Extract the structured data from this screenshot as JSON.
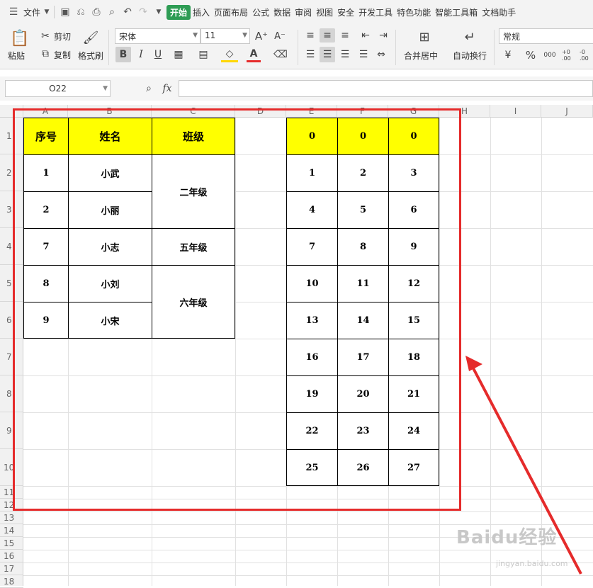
{
  "menu": {
    "file": "文件",
    "tabs": [
      "开始",
      "插入",
      "页面布局",
      "公式",
      "数据",
      "审阅",
      "视图",
      "安全",
      "开发工具",
      "特色功能",
      "智能工具箱",
      "文档助手"
    ]
  },
  "ribbon": {
    "paste": "粘贴",
    "cut": "剪切",
    "copy": "复制",
    "format_painter": "格式刷",
    "font_name": "宋体",
    "font_size": "11",
    "merge_center": "合并居中",
    "wrap_text": "自动换行",
    "number_format": "常规",
    "bold": "B",
    "italic": "I",
    "underline": "U",
    "font_color_glyph": "A",
    "percent": "%",
    "comma": "000",
    "dec_inc": "+0 .00",
    "dec_dec": "-0 .00"
  },
  "formula_bar": {
    "name_box": "O22",
    "fx": "fx",
    "formula": ""
  },
  "columns": [
    "A",
    "B",
    "C",
    "D",
    "E",
    "F",
    "G",
    "H",
    "I",
    "J"
  ],
  "rows": [
    "1",
    "2",
    "3",
    "4",
    "5",
    "6",
    "7",
    "8",
    "9",
    "10",
    "11",
    "12",
    "13",
    "14",
    "15",
    "16",
    "17",
    "18"
  ],
  "table1": {
    "headers": [
      "序号",
      "姓名",
      "班级"
    ],
    "ids": [
      "1",
      "2",
      "7",
      "8",
      "9"
    ],
    "names": [
      "小武",
      "小丽",
      "小志",
      "小刘",
      "小宋"
    ],
    "classes": [
      "二年级",
      "五年级",
      "六年级"
    ]
  },
  "table2": {
    "headers": [
      "0",
      "0",
      "0"
    ],
    "rows": [
      [
        "1",
        "2",
        "3"
      ],
      [
        "4",
        "5",
        "6"
      ],
      [
        "7",
        "8",
        "9"
      ],
      [
        "10",
        "11",
        "12"
      ],
      [
        "13",
        "14",
        "15"
      ],
      [
        "16",
        "17",
        "18"
      ],
      [
        "19",
        "20",
        "21"
      ],
      [
        "22",
        "23",
        "24"
      ],
      [
        "25",
        "26",
        "27"
      ]
    ]
  },
  "watermark": {
    "main": "Baidu经验",
    "sub": "jingyan.baidu.com"
  },
  "colors": {
    "highlight": "#ffff00",
    "annotation": "#e52b2b",
    "accent": "#2e9c54"
  }
}
